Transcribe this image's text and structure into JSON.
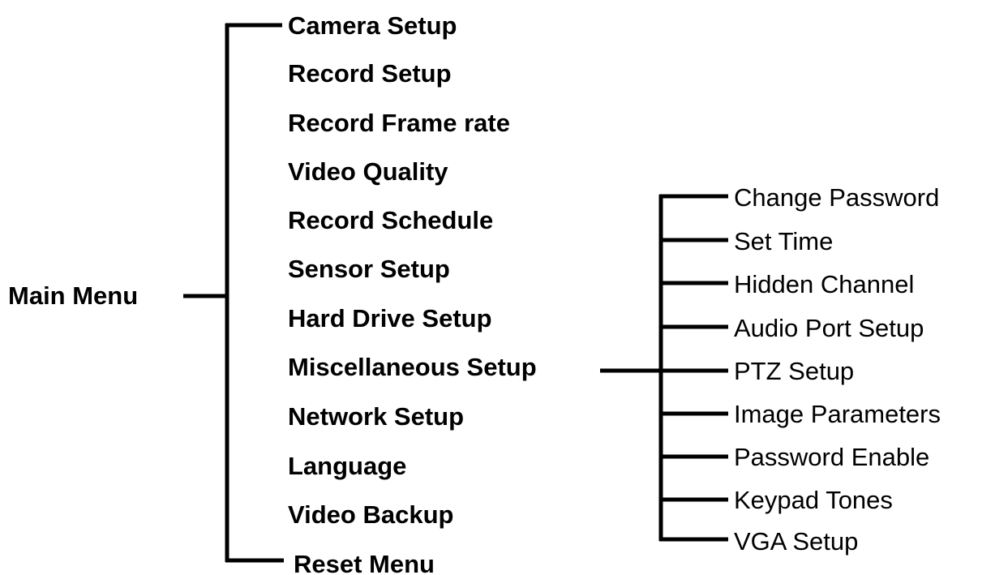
{
  "root": {
    "label": "Main Menu"
  },
  "main_menu": {
    "items": [
      {
        "label": "Camera Setup"
      },
      {
        "label": "Record Setup"
      },
      {
        "label": "Record Frame rate"
      },
      {
        "label": "Video Quality"
      },
      {
        "label": "Record Schedule"
      },
      {
        "label": "Sensor Setup"
      },
      {
        "label": "Hard Drive Setup"
      },
      {
        "label": "Miscellaneous Setup"
      },
      {
        "label": "Network Setup"
      },
      {
        "label": "Language"
      },
      {
        "label": "Video Backup"
      },
      {
        "label": "Reset Menu"
      }
    ]
  },
  "misc_submenu": {
    "items": [
      {
        "label": "Change Password"
      },
      {
        "label": "Set Time"
      },
      {
        "label": "Hidden Channel"
      },
      {
        "label": "Audio Port Setup"
      },
      {
        "label": "PTZ Setup"
      },
      {
        "label": "Image Parameters"
      },
      {
        "label": "Password Enable"
      },
      {
        "label": "Keypad Tones"
      },
      {
        "label": "VGA Setup"
      }
    ]
  },
  "colors": {
    "line": "#000000",
    "text": "#000000",
    "background": "#ffffff"
  }
}
